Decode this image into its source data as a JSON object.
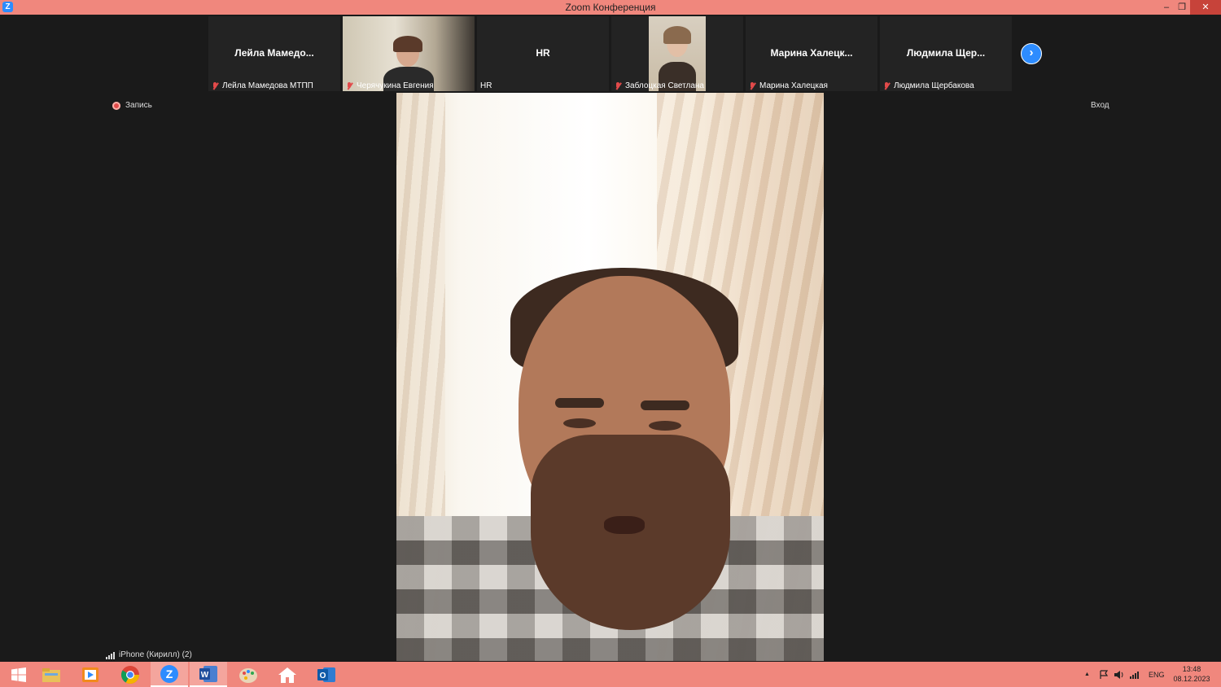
{
  "window": {
    "title": "Zoom Конференция",
    "min": "–",
    "max": "❐",
    "close": "✕"
  },
  "participants": [
    {
      "display_name": "Лейла  Мамедо...",
      "label": "Лейла Мамедова МТПП",
      "muted": true,
      "video": false
    },
    {
      "display_name": "",
      "label": "Черячукина Евгения",
      "muted": true,
      "video": true
    },
    {
      "display_name": "HR",
      "label": "HR",
      "muted": false,
      "video": false
    },
    {
      "display_name": "",
      "label": "Заблоцкая Светлана",
      "muted": true,
      "video": true
    },
    {
      "display_name": "Марина  Халецк...",
      "label": "Марина Халецкая",
      "muted": true,
      "video": false
    },
    {
      "display_name": "Людмила  Щер...",
      "label": "Людмила Щербакова",
      "muted": true,
      "video": false
    }
  ],
  "next_page": "›",
  "recording": {
    "label": "Запись"
  },
  "entry": {
    "label": "Вход"
  },
  "active_speaker": {
    "label": "iPhone (Кирилл) (2)"
  },
  "taskbar": {
    "apps": [
      "windows-start",
      "file-explorer",
      "media-player",
      "chrome",
      "zoom",
      "word",
      "paint",
      "home",
      "outlook"
    ],
    "tray_arrow": "▲",
    "language": "ENG",
    "time": "13:48",
    "date": "08.12.2023"
  },
  "colors": {
    "titlebar": "#f0877d",
    "background": "#1a1a1a",
    "tile": "#232323",
    "accent": "#2d8cff",
    "muted": "#e24a4a"
  }
}
